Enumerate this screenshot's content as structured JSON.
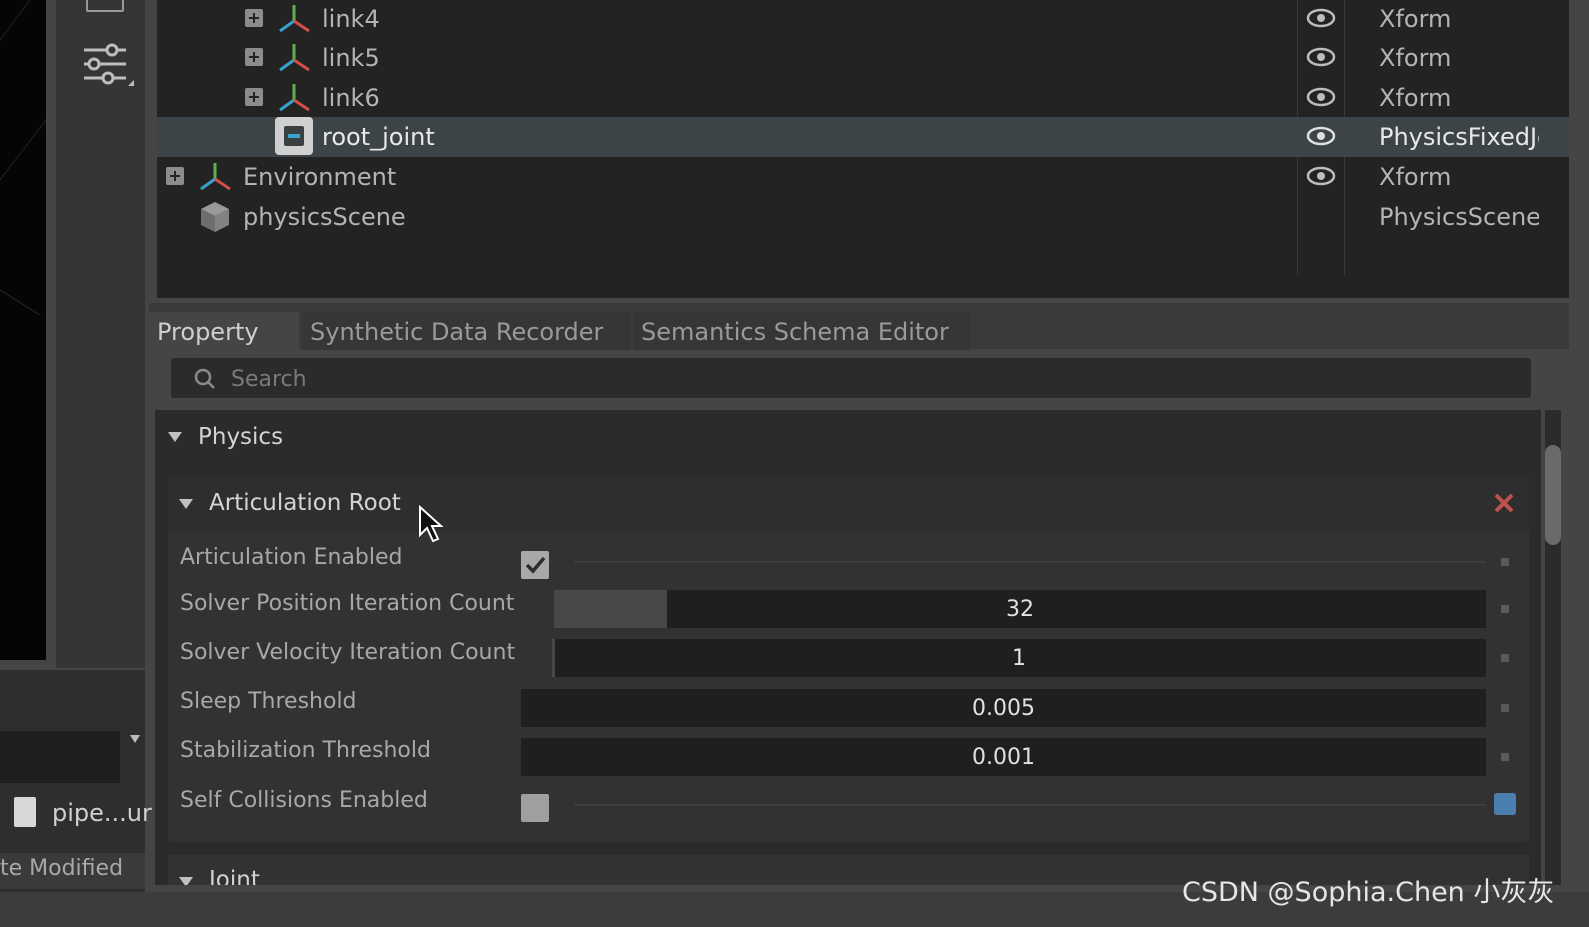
{
  "stage": {
    "rows": [
      {
        "name": "link4",
        "type": "Xform",
        "visible": true
      },
      {
        "name": "link5",
        "type": "Xform",
        "visible": true
      },
      {
        "name": "link6",
        "type": "Xform",
        "visible": true
      },
      {
        "name": "root_joint",
        "type": "PhysicsFixedJoint",
        "visible": true,
        "selected": true
      },
      {
        "name": "Environment",
        "type": "Xform",
        "visible": true
      },
      {
        "name": "physicsScene",
        "type": "PhysicsScene",
        "visible": false
      }
    ]
  },
  "tabs": {
    "property": "Property",
    "synthetic": "Synthetic Data Recorder",
    "semantics": "Semantics Schema Editor",
    "active": "Property"
  },
  "search": {
    "placeholder": "Search"
  },
  "physics": {
    "title": "Physics",
    "articulation_root": {
      "title": "Articulation Root",
      "articulation_enabled": {
        "label": "Articulation Enabled",
        "value": true
      },
      "solver_position": {
        "label": "Solver Position Iteration Count",
        "value": "32"
      },
      "solver_velocity": {
        "label": "Solver Velocity Iteration Count",
        "value": "1"
      },
      "sleep_threshold": {
        "label": "Sleep Threshold",
        "value": "0.005"
      },
      "stabilization_threshold": {
        "label": "Stabilization Threshold",
        "value": "0.001"
      },
      "self_collisions": {
        "label": "Self Collisions Enabled",
        "value": false
      }
    },
    "joint": {
      "title": "Joint"
    }
  },
  "left_panel": {
    "file_name": "pipe...ur",
    "column_header": "te Modified"
  },
  "watermark": "CSDN @Sophia.Chen 小灰灰",
  "colors": {
    "remove_x": "#c0504d",
    "accent_blue": "#4a7fb0",
    "axis_red": "#d0504a",
    "axis_green": "#5fb04a",
    "axis_blue": "#3aa0d0"
  }
}
